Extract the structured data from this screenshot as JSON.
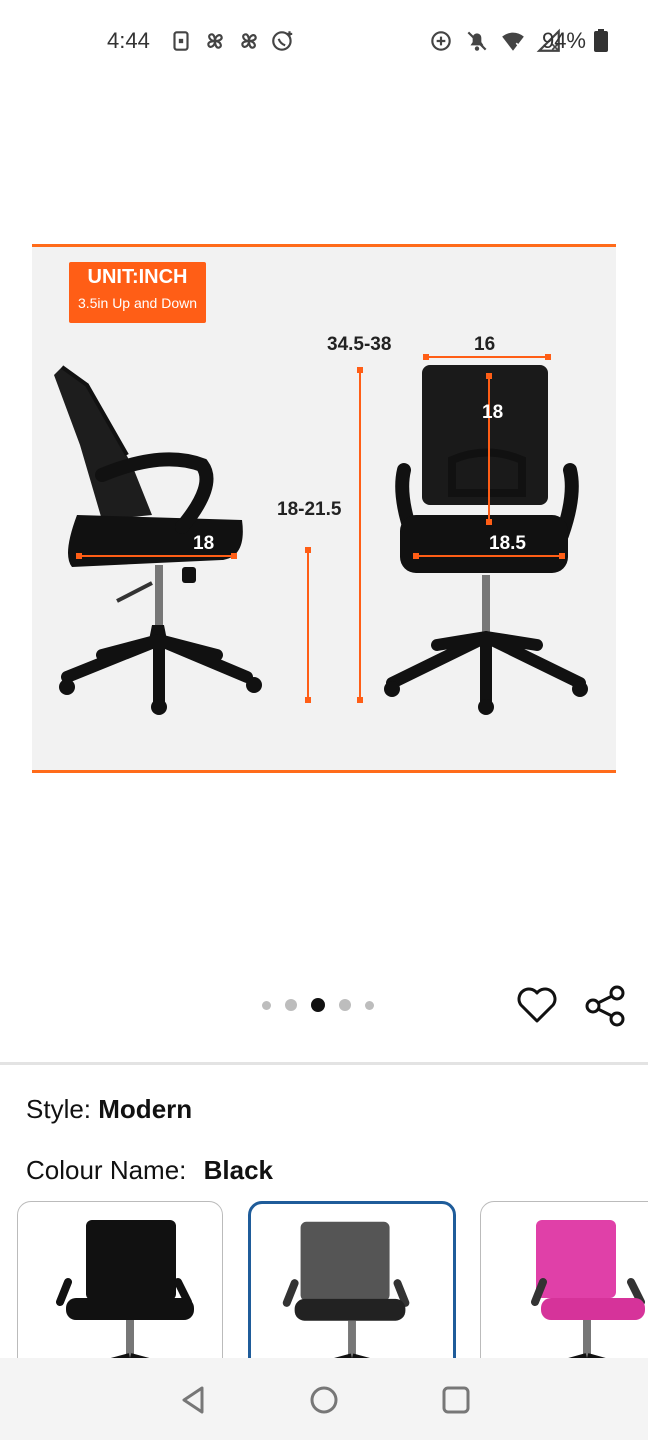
{
  "status_bar": {
    "time": "4:44",
    "battery_pct": "94%",
    "left_icons": [
      "sim-icon",
      "fan-icon",
      "fan-icon",
      "whatsapp-icon"
    ],
    "right_icons": [
      "data-saver-icon",
      "mute-icon",
      "wifi-icon",
      "no-signal-icon",
      "battery-icon"
    ]
  },
  "product_image": {
    "unit_title": "UNIT:INCH",
    "unit_sub": "3.5in Up and Down",
    "dims": {
      "overall_height": "34.5-38",
      "back_width": "16",
      "back_height": "18",
      "seat_height": "18-21.5",
      "seat_depth": "18",
      "seat_width": "18.5"
    },
    "accent_color": "#ff5e16"
  },
  "carousel": {
    "count": 5,
    "active_index": 2
  },
  "actions": {
    "favorite_icon": "heart-icon",
    "share_icon": "share-icon"
  },
  "style_row": {
    "label": "Style:",
    "value": "Modern"
  },
  "colour_row": {
    "label": "Colour Name:",
    "value": "Black"
  },
  "colour_options": [
    {
      "name": "black-chair",
      "color": "#111111",
      "selected": false
    },
    {
      "name": "grey-chair",
      "color": "#555555",
      "selected": true
    },
    {
      "name": "pink-chair",
      "color": "#e040a8",
      "selected": false
    }
  ],
  "nav_bar": {
    "icons": [
      "back-icon",
      "home-icon",
      "recents-icon"
    ]
  }
}
